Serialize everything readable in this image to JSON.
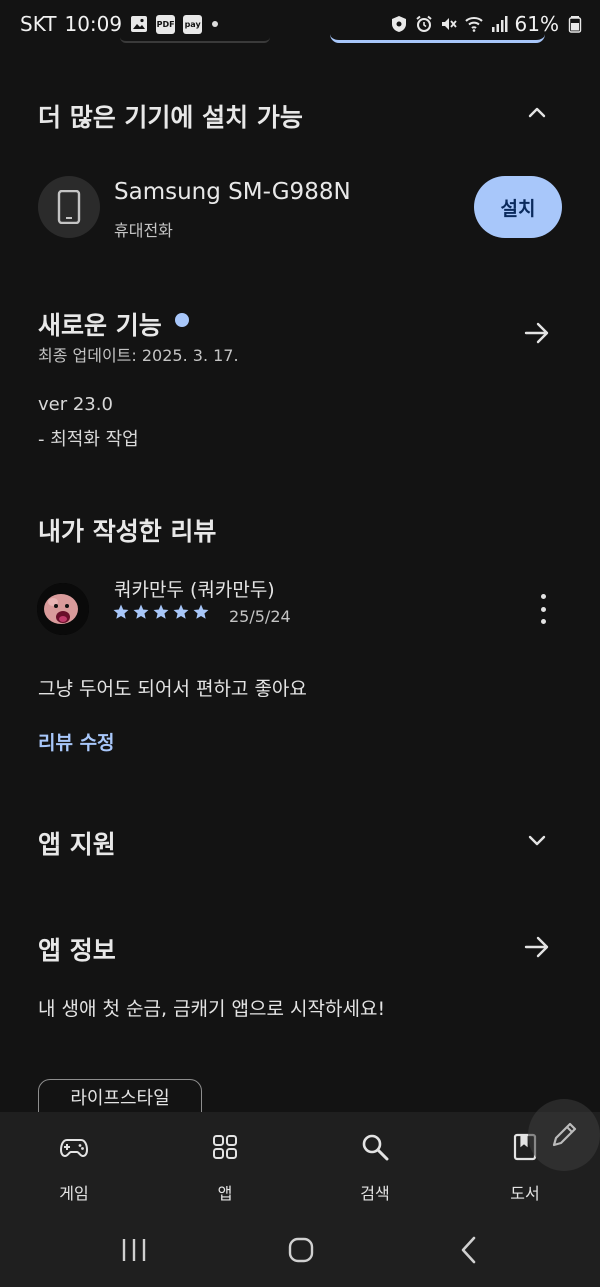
{
  "status_bar": {
    "carrier": "SKT",
    "time": "10:09",
    "pdf_badge": "PDF",
    "pay_badge": "pay",
    "battery": "61%"
  },
  "devices_section": {
    "title": "더 많은 기기에 설치 가능",
    "device_name": "Samsung SM-G988N",
    "device_type": "휴대전화",
    "install_label": "설치"
  },
  "whats_new": {
    "title": "새로운 기능",
    "updated": "최종 업데이트: 2025. 3. 17.",
    "version": "ver 23.0",
    "notes": "- 최적화 작업"
  },
  "my_review": {
    "title": "내가 작성한 리뷰",
    "reviewer": "쿼카만두 (쿼카만두)",
    "rating": 5,
    "date": "25/5/24",
    "body": "그냥 두어도 되어서 편하고 좋아요",
    "edit_label": "리뷰 수정"
  },
  "app_support": {
    "title": "앱 지원"
  },
  "app_info": {
    "title": "앱 정보",
    "description": "내 생애 첫 순금, 금캐기 앱으로 시작하세요!",
    "category_chip": "라이프스타일"
  },
  "bottom_nav": {
    "items": [
      {
        "label": "게임",
        "icon": "gamepad-icon"
      },
      {
        "label": "앱",
        "icon": "apps-grid-icon"
      },
      {
        "label": "검색",
        "icon": "search-icon"
      },
      {
        "label": "도서",
        "icon": "book-icon"
      }
    ]
  },
  "colors": {
    "background": "#131313",
    "accent": "#a8c7fa",
    "nav_bar": "#1f1f1f"
  }
}
